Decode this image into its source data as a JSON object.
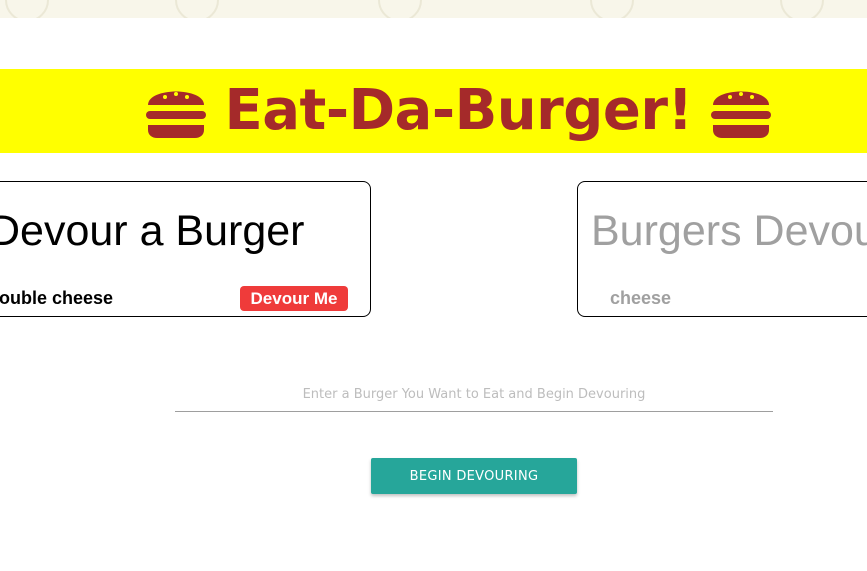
{
  "header": {
    "title": "Eat-Da-Burger!",
    "icon": "hamburger-icon",
    "background_color": "#ffff00",
    "text_color": "#a52a2a"
  },
  "undevoured_panel": {
    "heading": "Devour a Burger",
    "burgers": [
      {
        "name": "double cheese",
        "button_label": "Devour Me"
      }
    ]
  },
  "devoured_panel": {
    "heading": "Burgers Devoured",
    "burgers": [
      {
        "name": "cheese"
      }
    ]
  },
  "form": {
    "input_placeholder": "Enter a Burger You Want to Eat and Begin Devouring",
    "input_value": "",
    "submit_label": "BEGIN DEVOURING"
  },
  "colors": {
    "devour_button": "#ef3b3a",
    "submit_button": "#26a69a",
    "devoured_text": "#a0a0a0"
  }
}
